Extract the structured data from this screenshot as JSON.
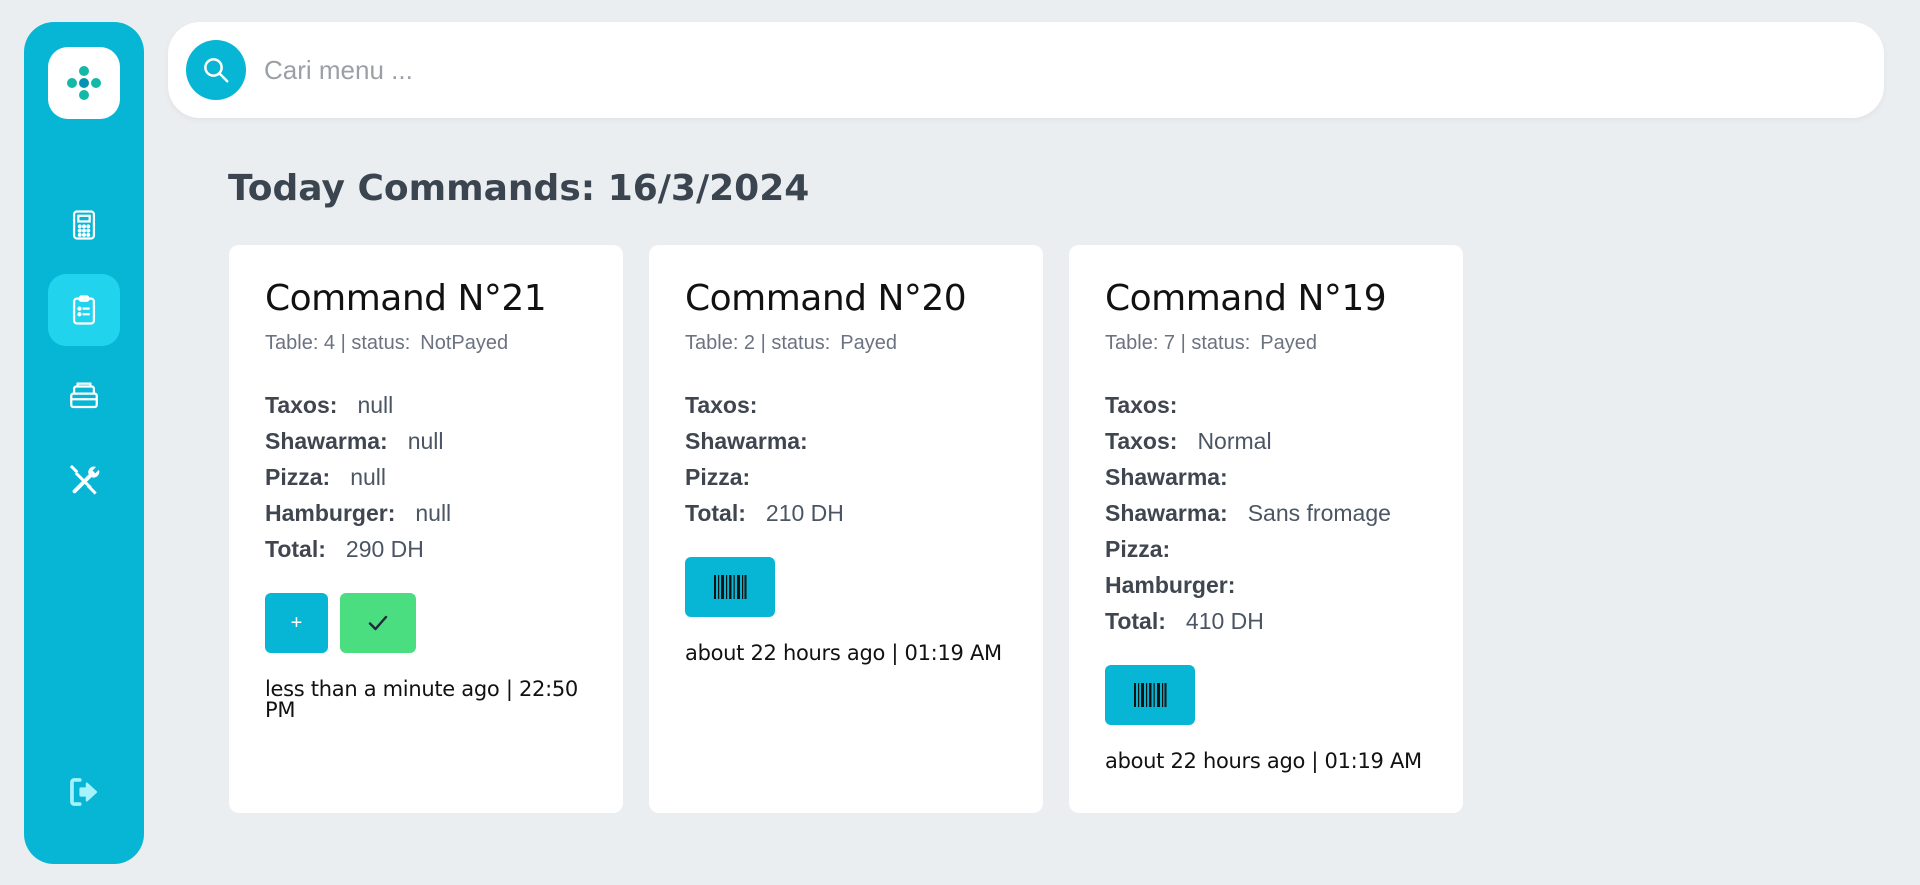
{
  "search": {
    "placeholder": "Cari menu ..."
  },
  "page": {
    "title": "Today Commands: 16/3/2024"
  },
  "sidebar": {
    "items": [
      {
        "icon": "calculator-icon",
        "active": false
      },
      {
        "icon": "clipboard-icon",
        "active": true
      },
      {
        "icon": "box-stack-icon",
        "active": false
      },
      {
        "icon": "tools-icon",
        "active": false
      }
    ],
    "logout_icon": "logout-icon"
  },
  "colors": {
    "accent": "#06b6d4",
    "accent_light": "#22d3ee",
    "success": "#4ade80",
    "background": "#ebeef1"
  },
  "commands": [
    {
      "title": "Command N°21",
      "table_label": "Table: 4 | status:",
      "status": "NotPayed",
      "items": [
        {
          "label": "Taxos:",
          "value": "null"
        },
        {
          "label": "Shawarma:",
          "value": "null"
        },
        {
          "label": "Pizza:",
          "value": "null"
        },
        {
          "label": "Hamburger:",
          "value": "null"
        },
        {
          "label": "Total:",
          "value": "290 DH"
        }
      ],
      "add_label": "+",
      "timestamp": "less than a minute ago | 22:50 PM"
    },
    {
      "title": "Command N°20",
      "table_label": "Table: 2 | status:",
      "status": "Payed",
      "items": [
        {
          "label": "Taxos:",
          "value": ""
        },
        {
          "label": "Shawarma:",
          "value": ""
        },
        {
          "label": "Pizza:",
          "value": ""
        },
        {
          "label": "Total:",
          "value": "210 DH"
        }
      ],
      "timestamp": "about 22 hours ago | 01:19 AM"
    },
    {
      "title": "Command N°19",
      "table_label": "Table: 7 | status:",
      "status": "Payed",
      "items": [
        {
          "label": "Taxos:",
          "value": ""
        },
        {
          "label": "Taxos:",
          "value": "Normal"
        },
        {
          "label": "Shawarma:",
          "value": ""
        },
        {
          "label": "Shawarma:",
          "value": "Sans fromage"
        },
        {
          "label": "Pizza:",
          "value": ""
        },
        {
          "label": "Hamburger:",
          "value": ""
        },
        {
          "label": "Total:",
          "value": "410 DH"
        }
      ],
      "timestamp": "about 22 hours ago | 01:19 AM"
    }
  ]
}
